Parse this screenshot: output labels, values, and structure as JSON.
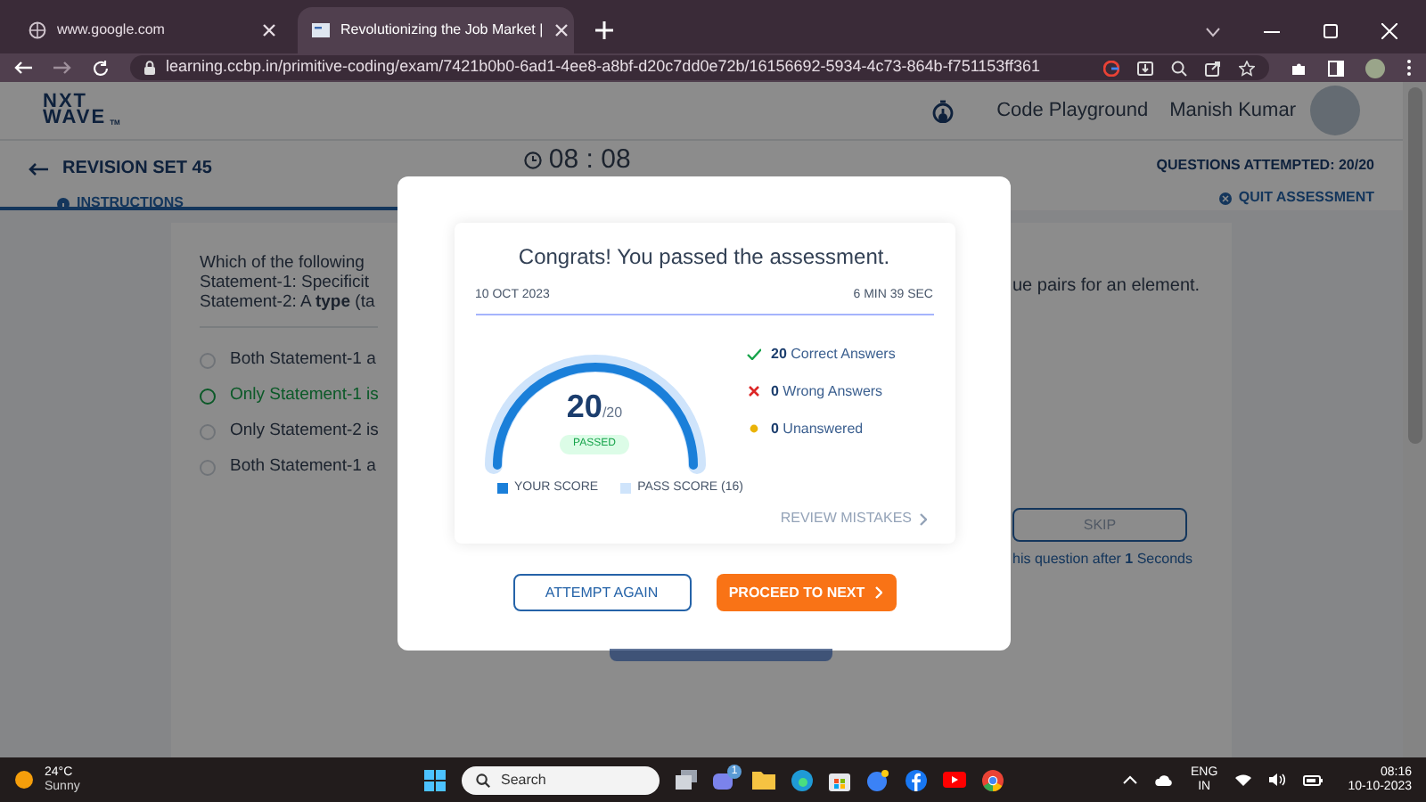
{
  "browser": {
    "tabs": [
      {
        "title": "www.google.com",
        "selected": false
      },
      {
        "title": "Revolutionizing the Job Market |",
        "selected": true
      }
    ],
    "url": "learning.ccbp.in/primitive-coding/exam/7421b0b0-6ad1-4ee8-a8bf-d20c7dd0e72b/16156692-5934-4c73-864b-f751153ff361"
  },
  "header": {
    "logo_line_1": "NXT",
    "logo_line_2": "WAVE",
    "logo_mark": "TM",
    "nav_link": "Code Playground",
    "user_name": "Manish Kumar"
  },
  "exam_bar": {
    "title": "REVISION SET 45",
    "tabs": [
      {
        "label": "INSTRUCTIONS",
        "selected": true
      }
    ],
    "timer": "08 : 08",
    "attempted": "QUESTIONS ATTEMPTED: 20/20",
    "quit": "QUIT ASSESSMENT"
  },
  "question": {
    "lines": [
      "Which of the following",
      "Statement-1: Specificit",
      "Statement-2: A **type** (ta"
    ],
    "line_right": "ue pairs for an element.",
    "options": [
      {
        "label": "Both Statement-1 a",
        "selected": false
      },
      {
        "label": "Only Statement-1 is",
        "selected": true
      },
      {
        "label": "Only Statement-2 is",
        "selected": false
      },
      {
        "label": "Both Statement-1 a",
        "selected": false
      }
    ],
    "skip": "SKIP",
    "skip_note": "his question after **1** Seconds"
  },
  "modal": {
    "title": "Congrats! You passed the assessment.",
    "date": "10 OCT 2023",
    "duration": "6 MIN 39 SEC",
    "gauge": {
      "score": "20",
      "total": "/20",
      "status": "PASSED",
      "level": 1
    },
    "stats": [
      {
        "kind": "correct",
        "count": "20",
        "label": "Correct Answers"
      },
      {
        "kind": "wrong",
        "count": "0",
        "label": "Wrong Answers"
      },
      {
        "kind": "unanswered",
        "count": "0",
        "label": "Unanswered"
      }
    ],
    "legend": [
      "YOUR SCORE",
      "PASS SCORE (16)"
    ],
    "review": "REVIEW MISTAKES",
    "buttons": [
      {
        "kind": "outline",
        "label": "ATTEMPT AGAIN"
      },
      {
        "kind": "primary",
        "label": "PROCEED TO NEXT"
      }
    ]
  },
  "taskbar": {
    "temperature": "24°C",
    "weather": "Sunny",
    "search": "Search",
    "teams_badge": "1",
    "language": "ENG",
    "region": "IN",
    "time": "08:16",
    "date": "10-10-2023"
  }
}
